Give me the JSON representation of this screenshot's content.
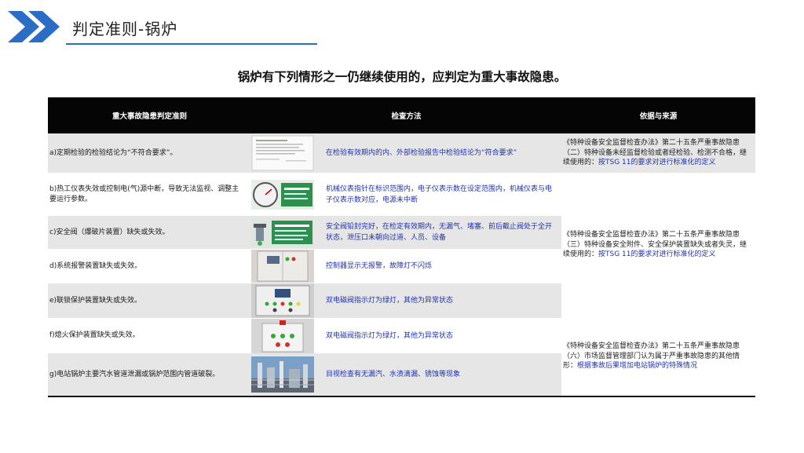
{
  "header": {
    "title": "判定准则-锅炉"
  },
  "headline": "锅炉有下列情形之一仍继续使用的，应判定为重大事故隐患。",
  "table": {
    "columns": [
      "重大事故隐患判定准则",
      "检查方法",
      "依据与来源"
    ],
    "rows": [
      {
        "criterion": "a)定期检验的检验结论为“不符合要求”。",
        "method": "在检验有效期内的内、外部检验报告中检验结论为“符合要求”",
        "image": "inspection-report-icon"
      },
      {
        "criterion": "b)热工仪表失效或控制电(气)源中断，导致无法监视、调整主要运行参数。",
        "method": "机械仪表指针在标识范围内，电子仪表示数在设定范围内，机械仪表与电子仪表示数对应，电源未中断",
        "image": "pressure-gauge-icon"
      },
      {
        "criterion": "c)安全阀（爆破片装置）缺失或失效。",
        "method": "安全阀铅封完好，在检定有效期内，无漏气、堵塞、前后截止阀处于全开状态，泄压口未朝向过道、人员、设备",
        "image": "safety-valve-icon"
      },
      {
        "criterion": "d)系统报警装置缺失或失效。",
        "method": "控制器显示无报警，故障灯不闪烁",
        "image": "control-cabinet-icon"
      },
      {
        "criterion": "e)联锁保护装置缺失或失效。",
        "method": "双电磁阀指示灯为绿灯，其他为异常状态",
        "image": "control-panel-icon"
      },
      {
        "criterion": "f)熄火保护装置缺失或失效。",
        "method": "双电磁阀指示灯为绿灯，其他为异常状态",
        "image": "indicator-panel-icon"
      },
      {
        "criterion": "g)电站锅炉主要汽水管道泄漏或锅炉范围内管道破裂。",
        "method": "目视检查有无漏汽、水渍滴漏、锈蚀等现象",
        "image": "power-plant-icon"
      }
    ],
    "sources": [
      {
        "text": "《特种设备安全监督检查办法》第二十五条严重事故隐患（二）特种设备未经监督检验或者经检验、检测不合格，继续使用的：",
        "highlight": "按TSG 11的要求对进行标准化的定义"
      },
      {
        "text": "《特种设备安全监督检查办法》第二十五条严重事故隐患（三）特种设备安全附件、安全保护装置缺失或者失灵，继续使用的：",
        "highlight": "按TSG 11的要求对进行标准化的定义"
      },
      {
        "text": "《特种设备安全监督检查办法》第二十五条严重事故隐患（六）市场监督管理部门认为属于严重事故隐患的其他情形：",
        "highlight": "根据事故后果增加电站锅炉的特殊情况"
      }
    ]
  }
}
